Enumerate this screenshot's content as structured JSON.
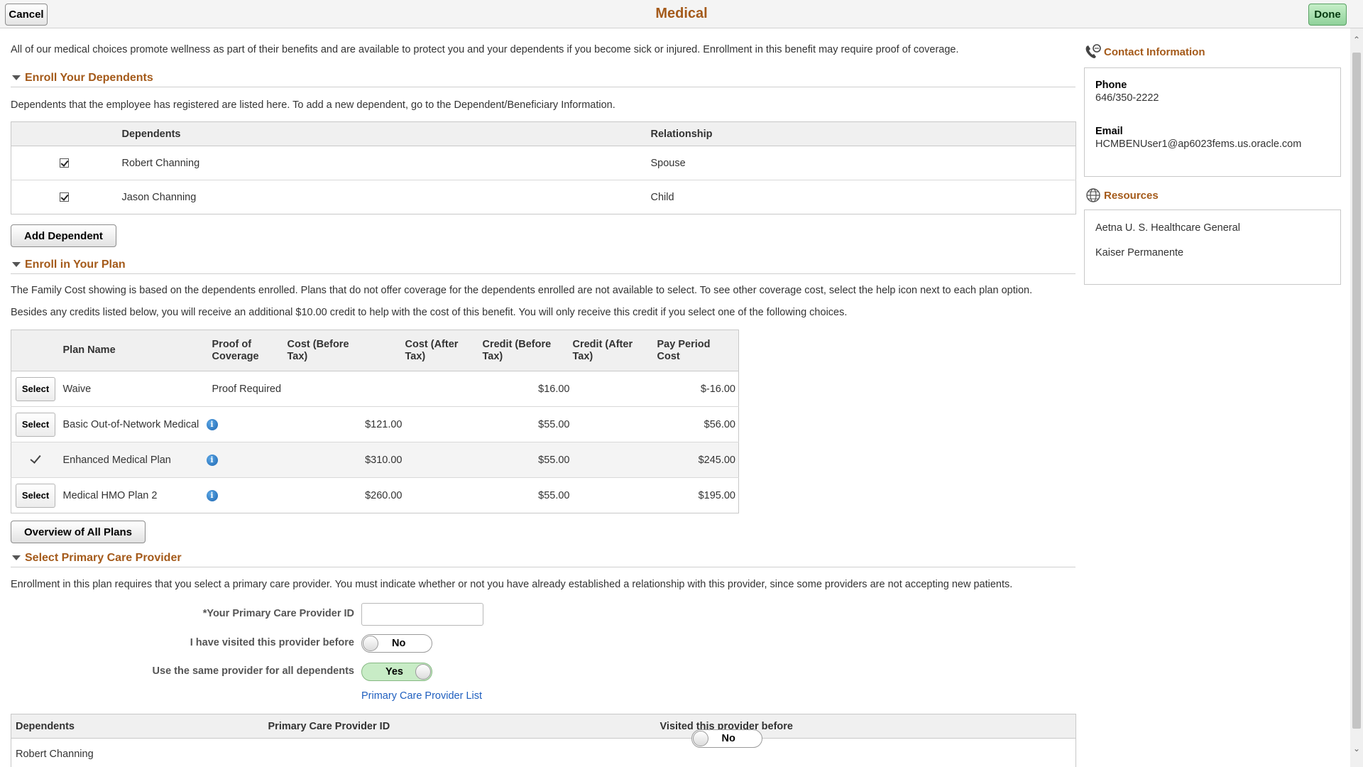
{
  "header": {
    "title": "Medical",
    "cancel_label": "Cancel",
    "done_label": "Done"
  },
  "intro": "All of our medical choices promote wellness as part of their benefits and are available to protect you and your dependents if you become sick or injured. Enrollment in this benefit may require proof of coverage.",
  "dependents_section": {
    "title": "Enroll Your Dependents",
    "note": "Dependents that the employee has registered are listed here. To add a new dependent, go to the Dependent/Beneficiary Information.",
    "columns": [
      "Dependents",
      "Relationship"
    ],
    "rows": [
      {
        "name": "Robert Channing",
        "relationship": "Spouse",
        "checked": true
      },
      {
        "name": "Jason Channing",
        "relationship": "Child",
        "checked": true
      }
    ],
    "add_button": "Add Dependent"
  },
  "plan_section": {
    "title": "Enroll in Your Plan",
    "note1": "The Family Cost showing is based on the dependents enrolled. Plans that do not offer coverage for the dependents enrolled are not available to select. To see other coverage cost, select the help icon next to each plan option.",
    "note2": "Besides any credits listed below, you will receive an additional $10.00 credit to help with the cost of this benefit.  You will only receive this credit if you select one of the following choices.",
    "columns": {
      "plan_name": "Plan Name",
      "proof_line1": "Proof of",
      "proof_line2": "Coverage",
      "cost_before_line1": "Cost (Before",
      "cost_before_line2": "Tax)",
      "cost_after_line1": "Cost (After",
      "cost_after_line2": "Tax)",
      "credit_before_line1": "Credit (Before",
      "credit_before_line2": "Tax)",
      "credit_after_line1": "Credit (After",
      "credit_after_line2": "Tax)",
      "pay_period_line1": "Pay Period",
      "pay_period_line2": "Cost"
    },
    "select_label": "Select",
    "plans": [
      {
        "name": "Waive",
        "proof": "Proof Required",
        "cost_before": "",
        "cost_after": "",
        "credit_before": "$16.00",
        "credit_after": "",
        "pay_period": "$-16.00",
        "selected": false,
        "info": false
      },
      {
        "name": "Basic Out-of-Network Medical",
        "proof": "",
        "cost_before": "$121.00",
        "cost_after": "",
        "credit_before": "$55.00",
        "credit_after": "",
        "pay_period": "$56.00",
        "selected": false,
        "info": true
      },
      {
        "name": "Enhanced Medical Plan",
        "proof": "",
        "cost_before": "$310.00",
        "cost_after": "",
        "credit_before": "$55.00",
        "credit_after": "",
        "pay_period": "$245.00",
        "selected": true,
        "info": true
      },
      {
        "name": "Medical HMO Plan 2",
        "proof": "",
        "cost_before": "$260.00",
        "cost_after": "",
        "credit_before": "$55.00",
        "credit_after": "",
        "pay_period": "$195.00",
        "selected": false,
        "info": true
      }
    ],
    "overview_button": "Overview of All Plans"
  },
  "provider_section": {
    "title": "Select Primary Care Provider",
    "note": "Enrollment in this plan requires that you select a primary care provider. You must indicate whether or not you have already established a relationship with this provider, since some providers are not accepting new patients.",
    "provider_id_label": "*Your Primary Care Provider ID",
    "provider_id_value": "",
    "visited_label": "I have visited this provider before",
    "visited_value": "No",
    "same_provider_label": "Use the same provider for all dependents",
    "same_provider_value": "Yes",
    "list_link": "Primary Care Provider List",
    "table_columns": [
      "Dependents",
      "Primary Care Provider ID",
      "Visited this provider before"
    ],
    "table_rows": [
      {
        "name": "Robert Channing",
        "provider_id": "",
        "visited": "No"
      }
    ]
  },
  "contact": {
    "title": "Contact Information",
    "phone_label": "Phone",
    "phone": "646/350-2222",
    "email_label": "Email",
    "email": "HCMBENUser1@ap6023fems.us.oracle.com"
  },
  "resources": {
    "title": "Resources",
    "links": [
      "Aetna U. S. Healthcare General",
      "Kaiser Permanente"
    ]
  },
  "colors": {
    "section_title": "#a45a1a",
    "link": "#1f5fbf",
    "done_button": "#8fd19a",
    "toggle_on": "#c8ecc6"
  }
}
